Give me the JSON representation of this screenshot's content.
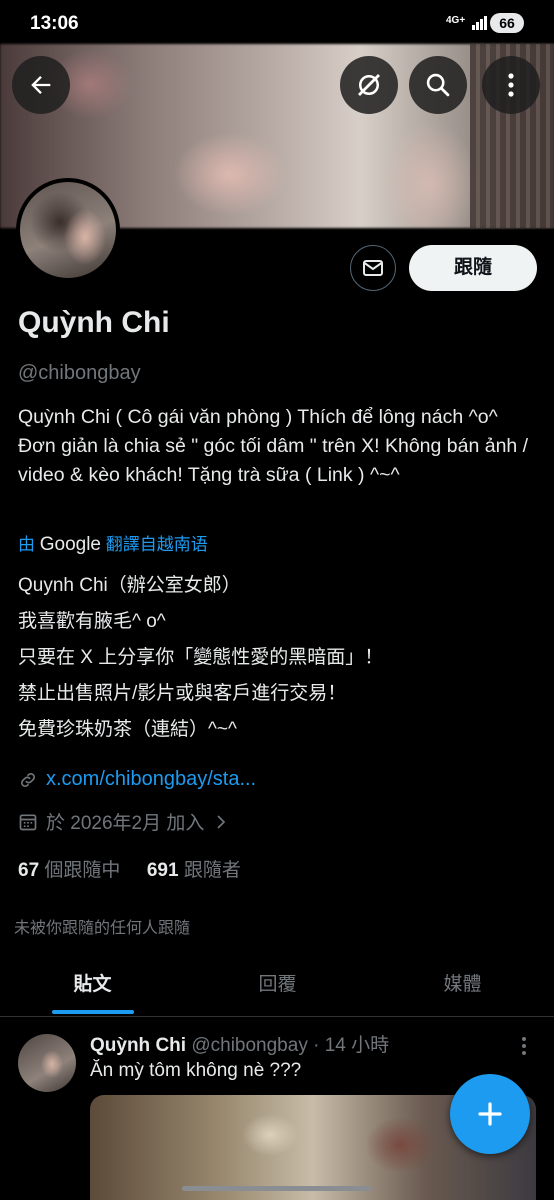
{
  "status_bar": {
    "time": "13:06",
    "network": "4G+",
    "battery": "66"
  },
  "profile": {
    "name": "Quỳnh Chi",
    "handle": "@chibongbay",
    "follow_label": "跟隨",
    "bio": "Quỳnh Chi ( Cô gái văn phòng ) Thích để lông nách ^o^ Đơn giản là chia sẻ \" góc tối dâm \" trên X! Không bán ảnh / video & kèo khách! Tặng trà sữa ( Link ) ^~^",
    "translate": {
      "prefix": "由",
      "brand": "Google",
      "suffix": "翻譯自越南语"
    },
    "translated_bio": [
      "Quynh Chi（辦公室女郎）",
      "我喜歡有腋毛^ o^",
      "只要在 X 上分享你「變態性愛的黑暗面」！",
      "禁止出售照片/影片或與客戶進行交易！",
      "免費珍珠奶茶（連結）^~^"
    ],
    "link": "x.com/chibongbay/sta...",
    "joined": "於 2026年2月 加入",
    "following_count": "67",
    "following_label": "個跟隨中",
    "followers_count": "691",
    "followers_label": "跟隨者",
    "not_followed_text": "未被你跟隨的任何人跟隨"
  },
  "tabs": [
    {
      "label": "貼文"
    },
    {
      "label": "回覆"
    },
    {
      "label": "媒體"
    }
  ],
  "post": {
    "author": "Quỳnh Chi",
    "handle": "@chibongbay",
    "time": "· 14 小時",
    "text": "Ăn mỳ tôm không nè ???"
  },
  "colors": {
    "accent": "#1d9bf0",
    "background": "#000000",
    "muted": "#71767b"
  },
  "icons": [
    "back-arrow-icon",
    "grok-icon",
    "search-icon",
    "more-vertical-icon",
    "mail-icon",
    "link-icon",
    "calendar-icon",
    "chevron-right-icon",
    "compose-plus-icon"
  ]
}
